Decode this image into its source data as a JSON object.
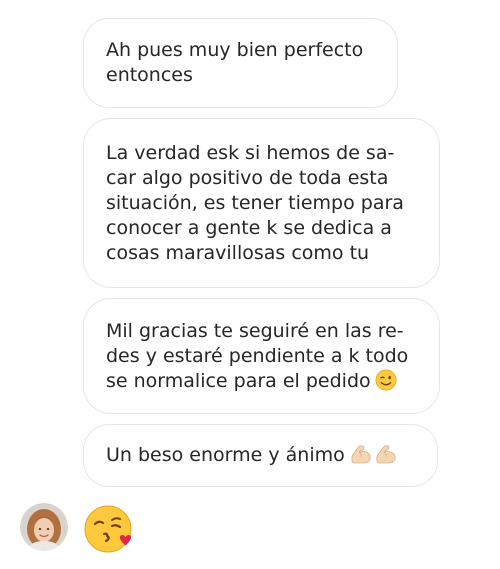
{
  "messages": [
    {
      "lines": [
        "Ah pues muy bien perfecto",
        "entonces"
      ]
    },
    {
      "lines": [
        "La verdad esk si hemos de sa-",
        "car algo positivo de toda esta",
        "situación, es tener tiempo para",
        "conocer a gente k se dedica a",
        "cosas maravillosas como tu"
      ]
    },
    {
      "lines": [
        "Mil gracias te seguiré en las re-",
        "des y estaré pendiente a k todo",
        "se normalice para el pedido"
      ],
      "emoji": "winking-face"
    },
    {
      "lines": [
        "Un beso enorme y ánimo"
      ],
      "emoji": "flexed-biceps x2"
    }
  ],
  "sender": {
    "avatar": "profile-photo"
  },
  "last_message": {
    "emoji": "face-blowing-a-kiss"
  },
  "colors": {
    "bubble_border": "#e6e6e6",
    "text": "#262626",
    "emoji_yellow": "#ffc83d",
    "kiss_heart": "#e8234b",
    "biceps_skin": "#f5d6b3"
  }
}
